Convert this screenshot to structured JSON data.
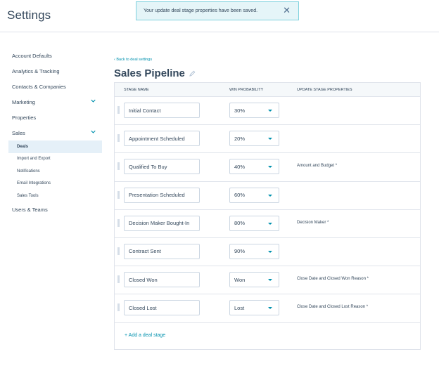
{
  "header": {
    "title": "Settings"
  },
  "toast": {
    "message": "Your update deal stage properties have been saved.",
    "close": "✕"
  },
  "sidebar": {
    "items": [
      {
        "label": "Account Defaults"
      },
      {
        "label": "Analytics & Tracking"
      },
      {
        "label": "Contacts & Companies"
      },
      {
        "label": "Marketing"
      },
      {
        "label": "Properties"
      },
      {
        "label": "Sales"
      }
    ],
    "sales_sub": [
      {
        "label": "Deals"
      },
      {
        "label": "Import and Export"
      },
      {
        "label": "Notifications"
      },
      {
        "label": "Email Integrations"
      },
      {
        "label": "Sales Tools"
      }
    ],
    "users_teams": "Users & Teams"
  },
  "main": {
    "back_link": "‹ Back to deal settings",
    "pipeline_title": "Sales Pipeline",
    "columns": [
      "STAGE NAME",
      "WIN PROBABILITY",
      "UPDATE STAGE PROPERTIES"
    ],
    "stages": [
      {
        "name": "Initial Contact",
        "probability": "30%",
        "properties": ""
      },
      {
        "name": "Appointment Scheduled",
        "probability": "20%",
        "properties": ""
      },
      {
        "name": "Qualified To Buy",
        "probability": "40%",
        "properties": "Amount and Budget *"
      },
      {
        "name": "Presentation Scheduled",
        "probability": "60%",
        "properties": ""
      },
      {
        "name": "Decision Maker Bought-In",
        "probability": "80%",
        "properties": "Decision Maker *"
      },
      {
        "name": "Contract Sent",
        "probability": "90%",
        "properties": ""
      },
      {
        "name": "Closed Won",
        "probability": "Won",
        "properties": "Close Date and Closed Won Reason *"
      },
      {
        "name": "Closed Lost",
        "probability": "Lost",
        "properties": "Close Date and Closed Lost Reason *"
      }
    ],
    "add_stage": "+ Add a deal stage"
  }
}
